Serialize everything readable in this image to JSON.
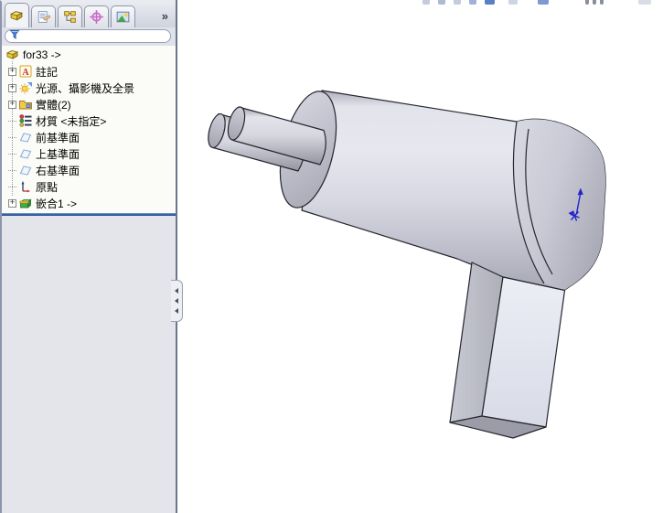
{
  "panel": {
    "tabs": [
      {
        "name": "featuremanager-tab",
        "icon": "part-icon",
        "active": true
      },
      {
        "name": "propertymanager-tab",
        "icon": "property-icon",
        "active": false
      },
      {
        "name": "configurationmanager-tab",
        "icon": "configuration-icon",
        "active": false
      },
      {
        "name": "dimxpertmanager-tab",
        "icon": "dimxpert-target-icon",
        "active": false
      },
      {
        "name": "displaymanager-tab",
        "icon": "display-image-icon",
        "active": false
      }
    ],
    "overflow_label": "»",
    "expand_glyph": "+",
    "filter": {
      "value": "",
      "icon": "filter-funnel-icon"
    }
  },
  "tree": {
    "items": [
      {
        "label": "for33 ->",
        "icon": "part-icon",
        "expandable": false
      },
      {
        "label": "註記",
        "icon": "annotations-icon",
        "expandable": true
      },
      {
        "label": "光源、攝影機及全景",
        "icon": "lights-cameras-scene-icon",
        "expandable": true
      },
      {
        "label": "實體(2)",
        "icon": "solid-bodies-folder-icon",
        "expandable": true
      },
      {
        "label": "材質 <未指定>",
        "icon": "material-icon",
        "expandable": false
      },
      {
        "label": "前基準面",
        "icon": "plane-icon",
        "expandable": false
      },
      {
        "label": "上基準面",
        "icon": "plane-icon",
        "expandable": false
      },
      {
        "label": "右基準面",
        "icon": "plane-icon",
        "expandable": false
      },
      {
        "label": "原點",
        "icon": "origin-icon",
        "expandable": false
      },
      {
        "label": "嵌合1 ->",
        "icon": "imported-body-icon",
        "expandable": true
      }
    ]
  },
  "viewport": {
    "model": "crank-shaft-part",
    "origin_marker": "blue-origin-triad"
  },
  "colors": {
    "split_line_accent": "#3c68b0",
    "panel_lower_bg": "#e3e5eb",
    "tree_bg": "#fbfbf7",
    "origin_marker_blue": "#2323cd",
    "model_highlight": "#e6e7ef",
    "model_mid": "#d7d8e2",
    "model_shadow": "#a6a7b3",
    "model_edge": "#26262e"
  }
}
